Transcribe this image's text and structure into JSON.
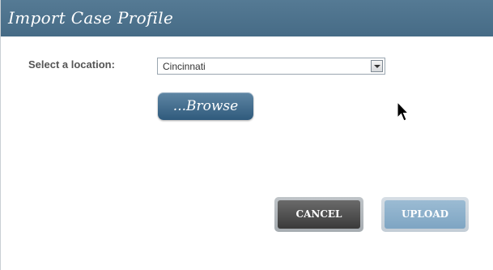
{
  "dialog": {
    "title": "Import Case Profile"
  },
  "location": {
    "label": "Select a location:",
    "selected": "Cincinnati"
  },
  "buttons": {
    "browse": "...Browse",
    "cancel": "CANCEL",
    "upload": "UPLOAD"
  },
  "colors": {
    "titlebar": "#4c7390",
    "browse": "#3e6a8c",
    "cancel": "#4a4a4a",
    "upload": "#8fb0ca"
  },
  "icons": {
    "dropdown": "chevron-down-icon",
    "cursor": "mouse-pointer-icon"
  }
}
